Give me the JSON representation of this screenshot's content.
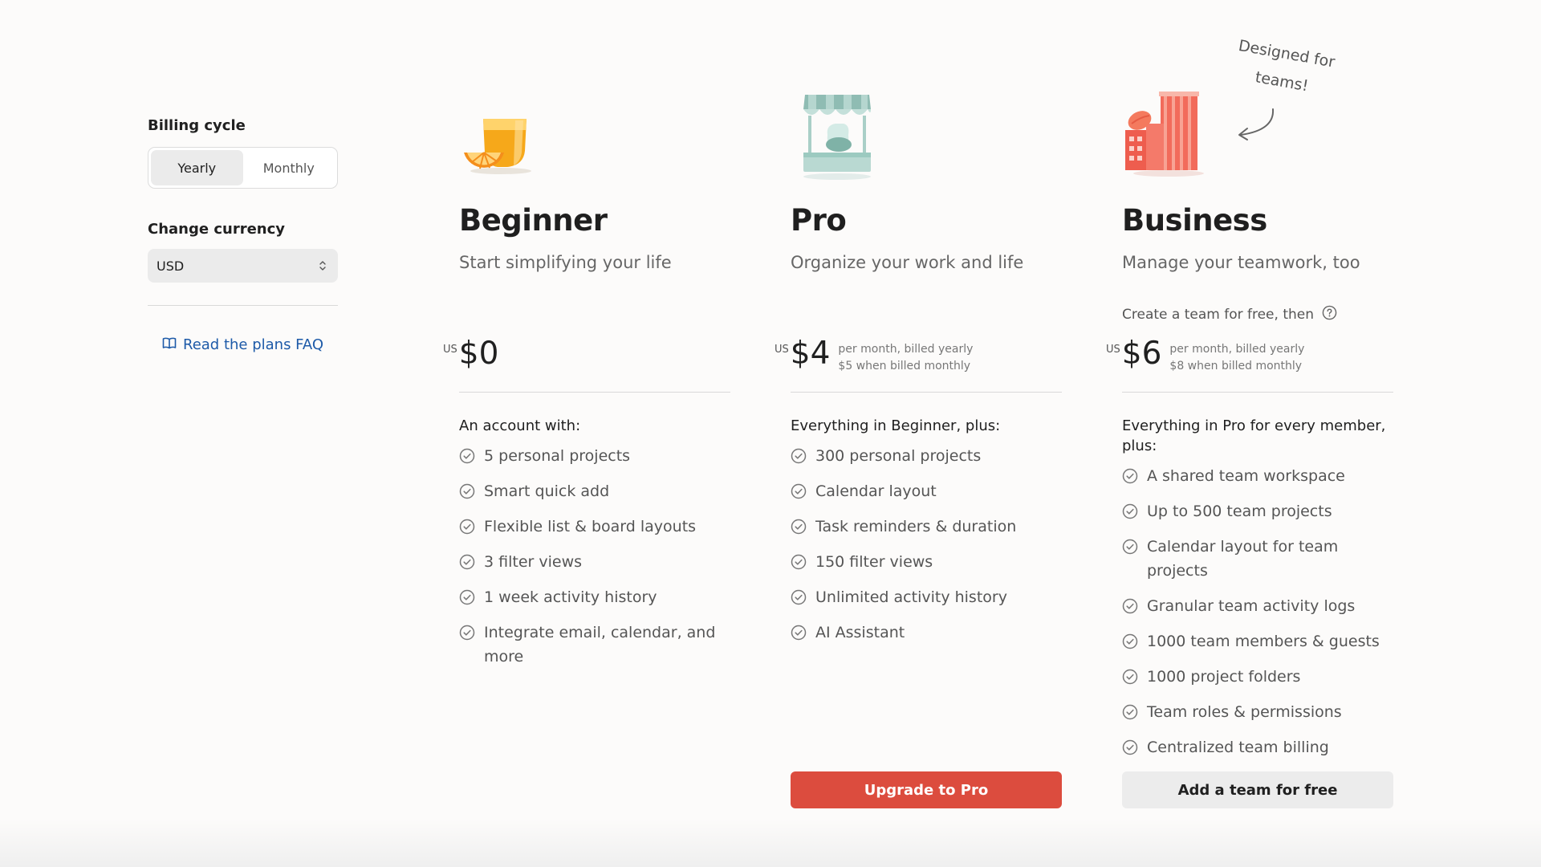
{
  "billing": {
    "label": "Billing cycle",
    "options": [
      "Yearly",
      "Monthly"
    ],
    "selected": "Yearly"
  },
  "currency": {
    "label": "Change currency",
    "value": "USD"
  },
  "faq": {
    "label": "Read the plans FAQ"
  },
  "annotation": {
    "line1": "Designed for",
    "line2": "teams!"
  },
  "plans": [
    {
      "name": "Beginner",
      "tagline": "Start simplifying your life",
      "price_prefix": "US",
      "price": "$0",
      "features_heading": "An account with:",
      "features": [
        "5 personal projects",
        "Smart quick add",
        "Flexible list & board layouts",
        "3 filter views",
        "1 week activity history",
        "Integrate email, calendar, and more"
      ]
    },
    {
      "name": "Pro",
      "tagline": "Organize your work and life",
      "price_prefix": "US",
      "price": "$4",
      "price_detail_1": "per month, billed yearly",
      "price_detail_2": "$5 when billed monthly",
      "features_heading": "Everything in Beginner, plus:",
      "features": [
        "300 personal projects",
        "Calendar layout",
        "Task reminders & duration",
        "150 filter views",
        "Unlimited activity history",
        "AI Assistant"
      ],
      "cta": "Upgrade to Pro"
    },
    {
      "name": "Business",
      "tagline": "Manage your teamwork, too",
      "note": "Create a team for free, then",
      "price_prefix": "US",
      "price": "$6",
      "price_detail_1": "per month, billed yearly",
      "price_detail_2": "$8 when billed monthly",
      "features_heading": "Everything in Pro for every member, plus:",
      "features": [
        "A shared team workspace",
        "Up to 500 team projects",
        "Calendar layout for team projects",
        "Granular team activity logs",
        "1000 team members & guests",
        "1000 project folders",
        "Team roles & permissions",
        "Centralized team billing"
      ],
      "cta": "Add a team for free"
    }
  ],
  "colors": {
    "accent_red": "#dc4c3e",
    "link_blue": "#1d5aa8"
  }
}
